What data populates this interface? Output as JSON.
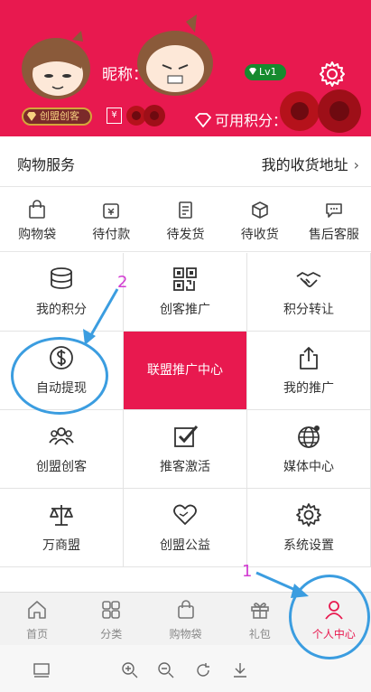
{
  "profile": {
    "nickname_label": "昵称：",
    "level": "Lv1",
    "member_badge": "创盟创客",
    "yen_symbol": "¥",
    "points_label": "可用积分："
  },
  "shopping": {
    "title": "购物服务",
    "address": "我的收货地址"
  },
  "orders": [
    "购物袋",
    "待付款",
    "待发货",
    "待收货",
    "售后客服"
  ],
  "grid": {
    "my_points": "我的积分",
    "maker_promo": "创客推广",
    "points_transfer": "积分转让",
    "auto_withdraw": "自动提现",
    "alliance_center": "联盟推广中心",
    "my_promo": "我的推广",
    "alliance_maker": "创盟创客",
    "recommend_activate": "推客激活",
    "media_center": "媒体中心",
    "wanshangmeng": "万商盟",
    "charity": "创盟公益",
    "settings": "系统设置"
  },
  "tabs": [
    "首页",
    "分类",
    "购物袋",
    "礼包",
    "个人中心"
  ],
  "annotations": {
    "one": "1",
    "two": "2"
  },
  "colors": {
    "brand": "#e8194f",
    "annotation_blue": "#3b9de0",
    "annotation_number": "#d23bd2"
  }
}
